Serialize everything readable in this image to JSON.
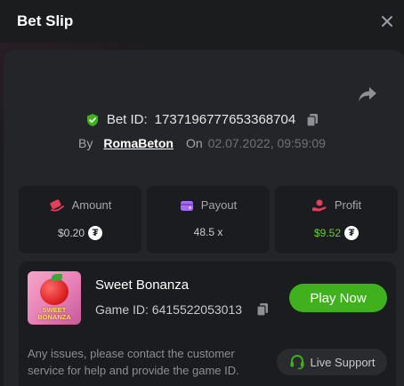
{
  "header": {
    "title": "Bet Slip",
    "close_icon": "close-icon"
  },
  "bet": {
    "id_label": "Bet ID:",
    "id_value": "1737196777653368704",
    "by_label": "By",
    "username": "RomaBeton",
    "on_label": "On",
    "datetime": "02.07.2022, 09:59:09"
  },
  "stats": [
    {
      "label": "Amount",
      "value": "$0.20",
      "icon": "amount-icon",
      "currency_icon": "tether-icon",
      "color": "#e0405a"
    },
    {
      "label": "Payout",
      "value": "48.5 x",
      "icon": "wallet-icon",
      "color": "#a56cf0"
    },
    {
      "label": "Profit",
      "value": "$9.52",
      "icon": "profit-icon",
      "currency_icon": "tether-icon",
      "color": "#e0405a",
      "value_color": "#6acb2a"
    }
  ],
  "game": {
    "name": "Sweet Bonanza",
    "id_label": "Game ID:",
    "id_value": "6415522053013",
    "thumb_text_line1": "SWEET",
    "thumb_text_line2": "BONANZA",
    "play_label": "Play Now"
  },
  "support": {
    "message": "Any issues, please contact the customer service for help and provide the game ID.",
    "button_label": "Live Support"
  },
  "colors": {
    "background": "#1b1c1e",
    "panel": "#242528",
    "card": "#1b1c1f",
    "accent_green": "#3fb11c",
    "profit_green": "#6acb2a"
  }
}
